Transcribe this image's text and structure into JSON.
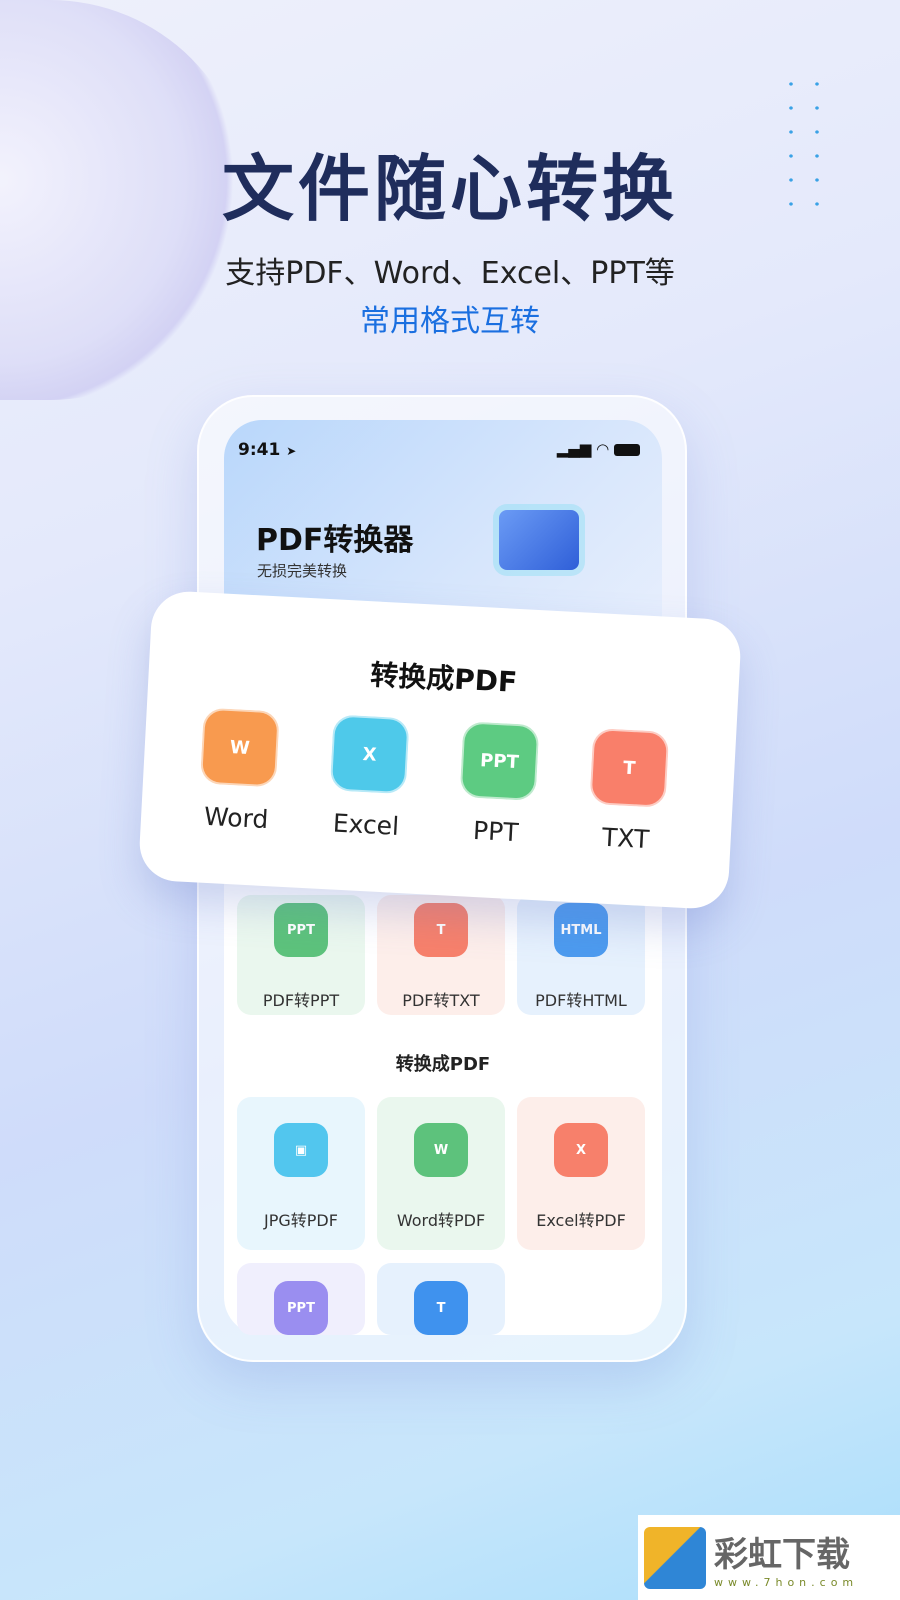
{
  "headline": "文件随心转换",
  "subline1": "支持PDF、Word、Excel、PPT等",
  "subline2": "常用格式互转",
  "status": {
    "time": "9:41",
    "location_icon": "➤",
    "signal_icon": "signal",
    "wifi_icon": "wifi",
    "battery_icon": "battery"
  },
  "app": {
    "title": "PDF转换器",
    "subtitle": "无损完美转换"
  },
  "card": {
    "title": "转换成PDF",
    "items": [
      {
        "label": "Word",
        "glyph": "W",
        "color": "#f89a4f"
      },
      {
        "label": "Excel",
        "glyph": "X",
        "color": "#4ec9ea"
      },
      {
        "label": "PPT",
        "glyph": "PPT",
        "color": "#5dcb82"
      },
      {
        "label": "TXT",
        "glyph": "T",
        "color": "#f97f6a"
      }
    ]
  },
  "grid1": [
    {
      "label": "PDF转PPT",
      "glyph": "PPT",
      "color": "#5dc27c",
      "bg": "#eaf7ee"
    },
    {
      "label": "PDF转TXT",
      "glyph": "T",
      "color": "#f7806b",
      "bg": "#fdeeea"
    },
    {
      "label": "PDF转HTML",
      "glyph": "HTML",
      "color": "#4c9bef",
      "bg": "#e6f1fd"
    }
  ],
  "section2": "转换成PDF",
  "grid2": [
    {
      "label": "JPG转PDF",
      "glyph": "▣",
      "color": "#52c6ee",
      "bg": "#e8f6fd"
    },
    {
      "label": "Word转PDF",
      "glyph": "W",
      "color": "#5dc27c",
      "bg": "#eaf7ee"
    },
    {
      "label": "Excel转PDF",
      "glyph": "X",
      "color": "#f7806b",
      "bg": "#fdeeea"
    },
    {
      "label": "",
      "glyph": "PPT",
      "color": "#9a8ef0",
      "bg": "#f0effd"
    },
    {
      "label": "",
      "glyph": "T",
      "color": "#3f92ee",
      "bg": "#e6f1fd"
    }
  ],
  "watermark": {
    "name": "彩虹下载",
    "url": "www.7hon.com"
  }
}
